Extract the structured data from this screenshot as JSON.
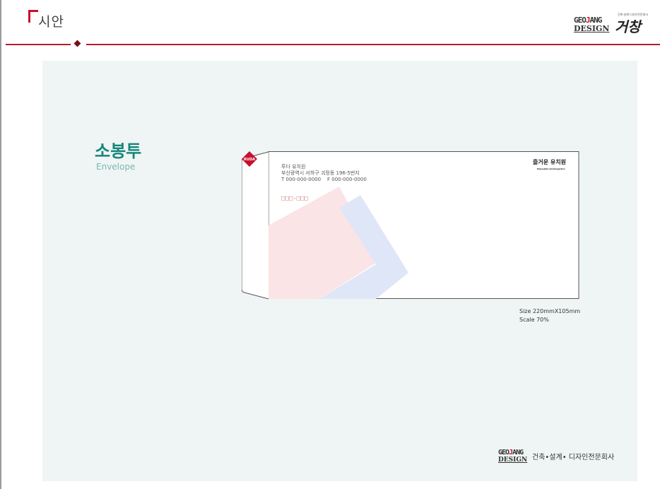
{
  "header": {
    "title": "시안"
  },
  "brand": {
    "geo": "GEO",
    "j": "J",
    "ang": "ANG",
    "design": "DESIGN",
    "hangul": "거창",
    "tagline": "건축·설계·디자인전문회사",
    "bottom_tag": "건축•설계• 디자인전문회사"
  },
  "section": {
    "title": "소봉투",
    "subtitle": "Envelope"
  },
  "envelope": {
    "sender_name": "루다 유치원",
    "sender_address": "부산광역시 서하구 괴정동 196-5번지",
    "sender_phone": "T 000-000-0000",
    "sender_fax": "F 000-000-0000",
    "zip_placeholder": "□□□-□□□",
    "logo_mark": "RUDA",
    "logo_name": "즐거운 유치원",
    "logo_name_en": "Enjoyable kindergarten",
    "accent_colors": {
      "red": "#c8102e",
      "pink": "#fbe4e6",
      "blue": "#dfe6f7"
    }
  },
  "spec": {
    "size": "Size 220mmX105mm",
    "scale": "Scale 70%"
  }
}
